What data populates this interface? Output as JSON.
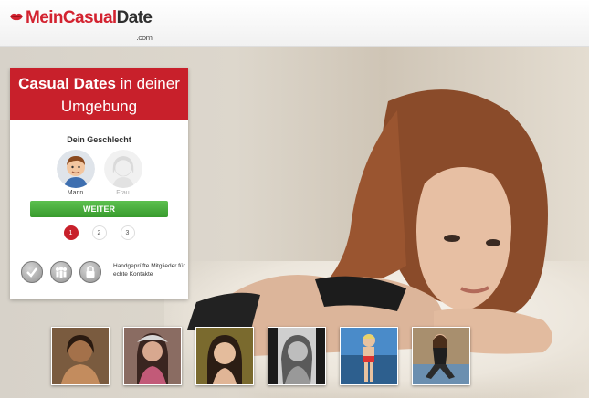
{
  "header": {
    "logo": {
      "mein": "Mein",
      "casual": "Casual",
      "date": "Date",
      "com": ".com"
    }
  },
  "panel": {
    "title_bold": "Casual Dates",
    "title_rest": " in deiner Umgebung",
    "gender_title": "Dein Geschlecht",
    "genders": [
      {
        "label": "Mann",
        "selected": true
      },
      {
        "label": "Frau",
        "selected": false
      }
    ],
    "button_label": "WEITER",
    "steps": [
      "1",
      "2",
      "3"
    ],
    "active_step": "1",
    "features": {
      "icons": [
        "check-icon",
        "group-icon",
        "lock-icon"
      ],
      "text": "Handgeprüfte Mitglieder für echte Kontakte"
    }
  },
  "thumbnails": [
    "profile-1",
    "profile-2",
    "profile-3",
    "profile-4",
    "profile-5",
    "profile-6"
  ],
  "colors": {
    "brand_red": "#c8202b",
    "button_green": "#3fa83a",
    "header_bg": "#ffffff"
  }
}
